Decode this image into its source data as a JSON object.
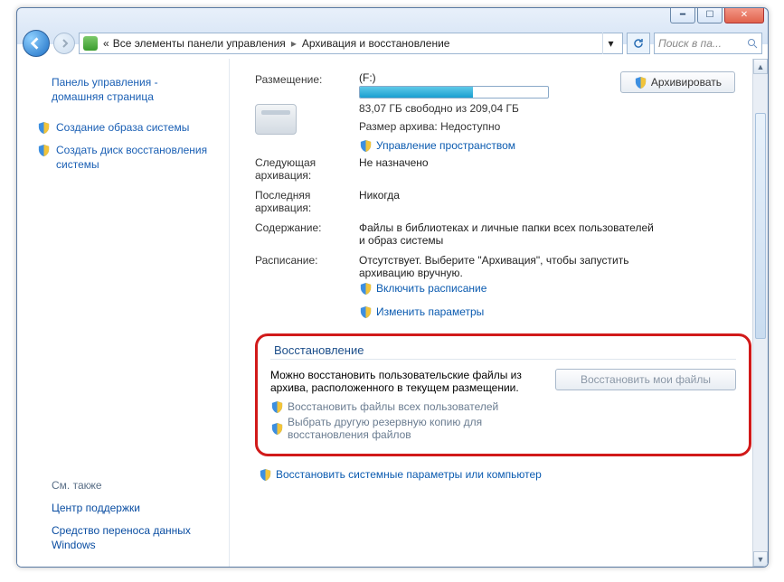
{
  "window": {
    "minimize": "_",
    "maximize": "□",
    "close": "×"
  },
  "breadcrumb": {
    "prefix": "«",
    "parts": [
      "Все элементы панели управления",
      "Архивация и восстановление"
    ]
  },
  "search": {
    "placeholder": "Поиск в па..."
  },
  "sidebar": {
    "home_line1": "Панель управления -",
    "home_line2": "домашняя страница",
    "items": [
      "Создание образа системы",
      "Создать диск восстановления системы"
    ],
    "see_also_hdr": "См. также",
    "see_also": [
      "Центр поддержки",
      "Средство переноса данных Windows"
    ]
  },
  "main": {
    "location_label": "Размещение:",
    "drive": "(F:)",
    "free_space": "83,07 ГБ свободно из 209,04 ГБ",
    "archive_size": "Размер архива: Недоступно",
    "manage_space": "Управление пространством",
    "archive_btn": "Архивировать",
    "rows": {
      "next_k": "Следующая архивация:",
      "next_v": "Не назначено",
      "last_k": "Последняя архивация:",
      "last_v": "Никогда",
      "content_k": "Содержание:",
      "content_v": "Файлы в библиотеках и личные папки всех пользователей и образ системы",
      "sched_k": "Расписание:",
      "sched_v": "Отсутствует. Выберите \"Архивация\", чтобы запустить архивацию вручную.",
      "sched_link": "Включить расписание",
      "change_link": "Изменить параметры"
    }
  },
  "recovery": {
    "legend": "Восстановление",
    "desc": "Можно восстановить пользовательские файлы из архива, расположенного в текущем размещении.",
    "link_all": "Восстановить файлы всех пользователей",
    "link_other": "Выбрать другую резервную копию для восстановления файлов",
    "btn": "Восстановить мои файлы"
  },
  "bottom_link": "Восстановить системные параметры или компьютер"
}
